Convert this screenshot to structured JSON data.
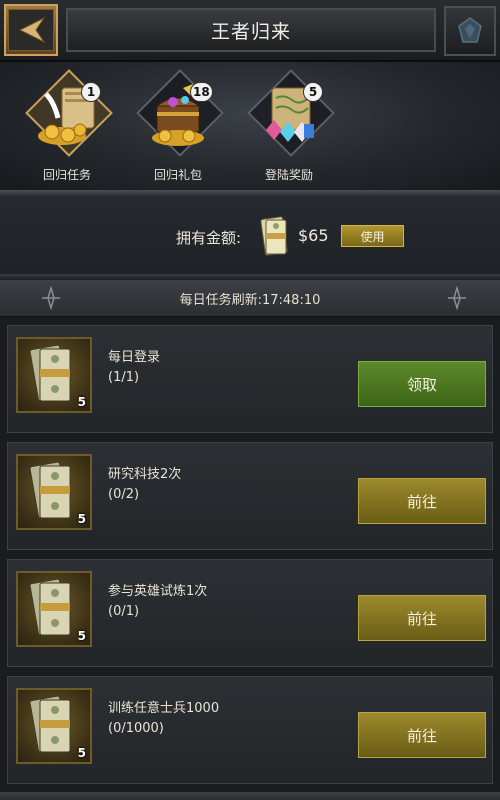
{
  "header": {
    "title": "王者归来"
  },
  "categories": [
    {
      "label": "回归任务",
      "badge": "1",
      "icon": "scroll-gold-icon",
      "active": true
    },
    {
      "label": "回归礼包",
      "badge": "18",
      "icon": "treasure-chest-icon",
      "active": false
    },
    {
      "label": "登陆奖励",
      "badge": "5",
      "icon": "gift-scroll-icon",
      "active": false
    }
  ],
  "currency": {
    "label": "拥有金额:",
    "amount": "$65",
    "use_label": "使用",
    "icon": "cash-stack-icon"
  },
  "refresh": {
    "text": "每日任务刷新:17:48:10"
  },
  "tasks": [
    {
      "name": "每日登录",
      "progress": "(1/1)",
      "reward_count": "5",
      "action": "领取",
      "action_state": "claim"
    },
    {
      "name": "研究科技2次",
      "progress": "(0/2)",
      "reward_count": "5",
      "action": "前往",
      "action_state": "go"
    },
    {
      "name": "参与英雄试炼1次",
      "progress": "(0/1)",
      "reward_count": "5",
      "action": "前往",
      "action_state": "go"
    },
    {
      "name": "训练任意士兵1000",
      "progress": "(0/1000)",
      "reward_count": "5",
      "action": "前往",
      "action_state": "go"
    }
  ],
  "colors": {
    "claim_button": "#4f7a24",
    "go_button": "#8a7a22",
    "accent_gold": "#c9a25c"
  }
}
